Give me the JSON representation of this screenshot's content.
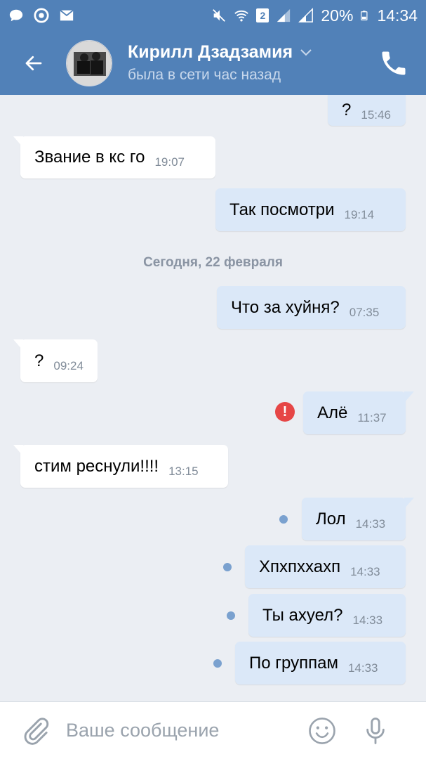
{
  "status_bar": {
    "battery": "20%",
    "time": "14:34",
    "sim_badge": "2",
    "icons": [
      "chat-bubble-icon",
      "chrome-icon",
      "mail-icon",
      "mute-icon",
      "wifi-icon",
      "signal-icon",
      "battery-icon"
    ]
  },
  "header": {
    "name": "Кирилл Дзадзамия",
    "status": "была в сети час назад",
    "accent": "#5181b8"
  },
  "messages": [
    {
      "dir": "out",
      "text": "?",
      "time": "15:46"
    },
    {
      "dir": "in",
      "text": "Звание в кс го",
      "time": "19:07"
    },
    {
      "dir": "out",
      "text": "Так посмотри",
      "time": "19:14"
    },
    {
      "date": "Сегодня, 22 февраля"
    },
    {
      "dir": "out",
      "text": "Что за хуйня?",
      "time": "07:35"
    },
    {
      "dir": "in",
      "text": "?",
      "time": "09:24"
    },
    {
      "dir": "out",
      "text": "Алё",
      "time": "11:37",
      "error": true
    },
    {
      "dir": "in",
      "text": "стим реснули!!!!",
      "time": "13:15"
    },
    {
      "dir": "out",
      "text": "Лол",
      "time": "14:33",
      "unread": true
    },
    {
      "dir": "out",
      "text": "Хпхпххахп",
      "time": "14:33",
      "unread": true
    },
    {
      "dir": "out",
      "text": "Ты ахуел?",
      "time": "14:33",
      "unread": true
    },
    {
      "dir": "out",
      "text": "По группам",
      "time": "14:33",
      "unread": true
    }
  ],
  "composer": {
    "placeholder": "Ваше сообщение"
  },
  "colors": {
    "incoming_bubble": "#ffffff",
    "outgoing_bubble": "#dbe8f8",
    "background": "#ebeef3",
    "error": "#e64646",
    "unread_dot": "#7aa1cf"
  }
}
